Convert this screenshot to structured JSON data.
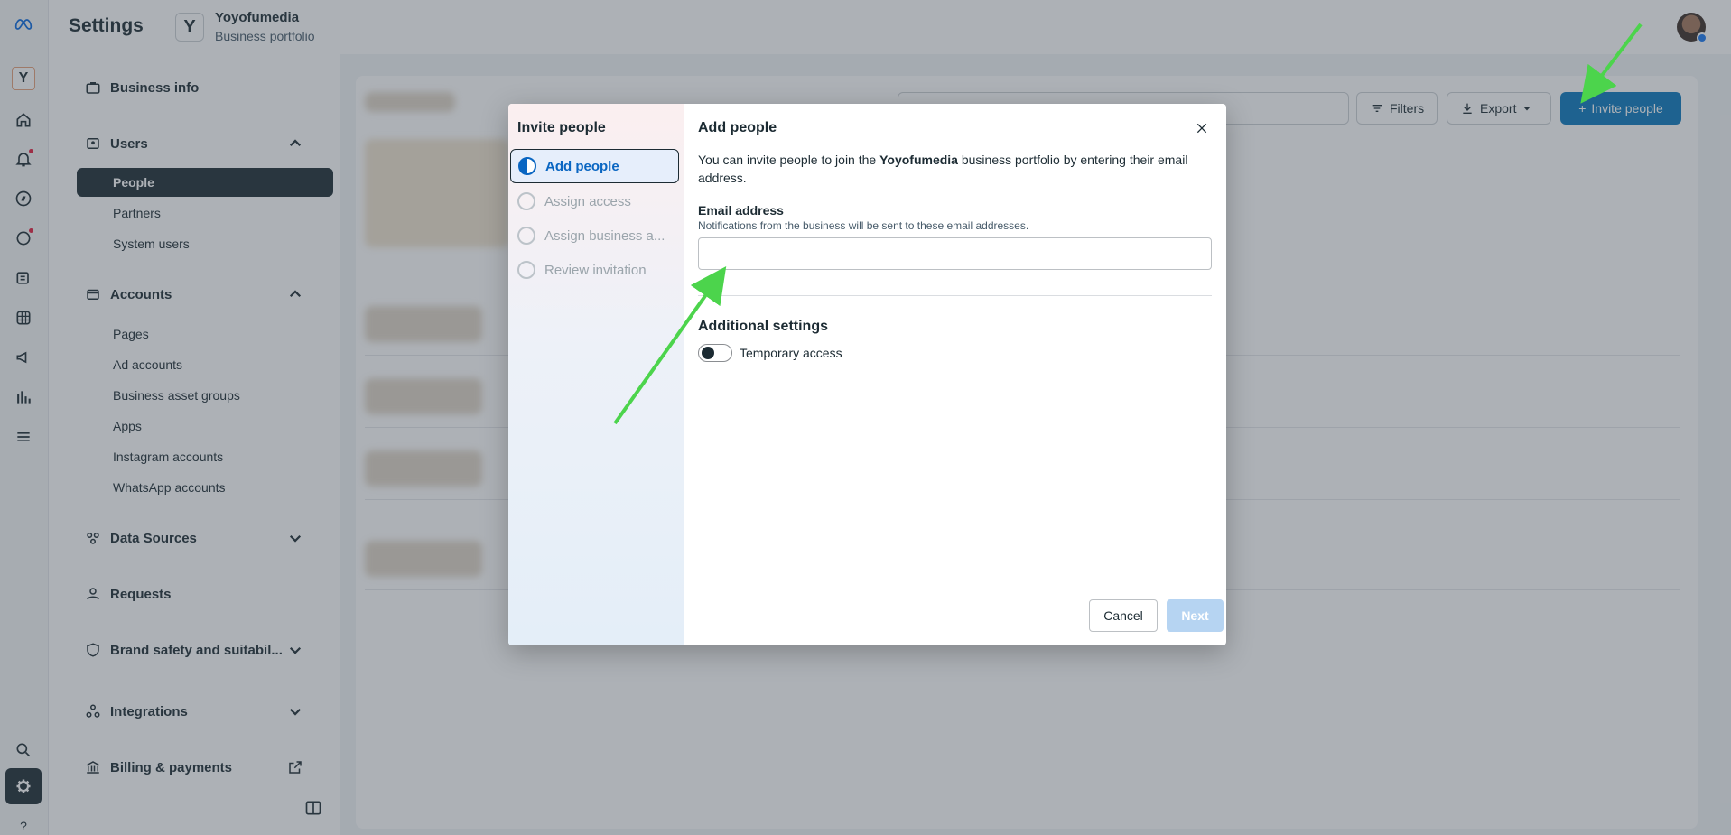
{
  "header": {
    "title": "Settings",
    "portfolio_logo_letter": "Y",
    "portfolio_name": "Yoyofumedia",
    "portfolio_subtitle": "Business portfolio"
  },
  "rail": {
    "logo_letter": "Y",
    "icons": [
      "meta-logo-icon",
      "home-icon",
      "bell-icon",
      "compass-icon",
      "chat-icon",
      "pages-icon",
      "grid-icon",
      "megaphone-icon",
      "chart-icon",
      "menu-icon",
      "search-icon",
      "gear-icon",
      "help-icon"
    ],
    "help_glyph": "?"
  },
  "sidebar": {
    "business_info": "Business info",
    "users": "Users",
    "users_items": [
      "People",
      "Partners",
      "System users"
    ],
    "accounts": "Accounts",
    "accounts_items": [
      "Pages",
      "Ad accounts",
      "Business asset groups",
      "Apps",
      "Instagram accounts",
      "WhatsApp accounts"
    ],
    "data_sources": "Data Sources",
    "requests": "Requests",
    "brand_safety": "Brand safety and suitabil...",
    "integrations": "Integrations",
    "billing": "Billing & payments"
  },
  "main": {
    "filters_label": "Filters",
    "export_label": "Export",
    "invite_label": "Invite people",
    "invite_plus": "+"
  },
  "modal": {
    "steps_title": "Invite people",
    "steps": [
      "Add people",
      "Assign access",
      "Assign business a...",
      "Review invitation"
    ],
    "panel_title": "Add people",
    "intro_before": "You can invite people to join the ",
    "intro_bold": "Yoyofumedia",
    "intro_after": " business portfolio by entering their email address.",
    "email_label": "Email address",
    "email_help": "Notifications from the business will be sent to these email addresses.",
    "email_value": "",
    "additional_title": "Additional settings",
    "temporary_access_label": "Temporary access",
    "temporary_access_on": false,
    "cancel_label": "Cancel",
    "next_label": "Next"
  },
  "colors": {
    "accent": "#0a78be",
    "dark": "#1c2b33",
    "annotation_arrow": "#4cd44c"
  }
}
